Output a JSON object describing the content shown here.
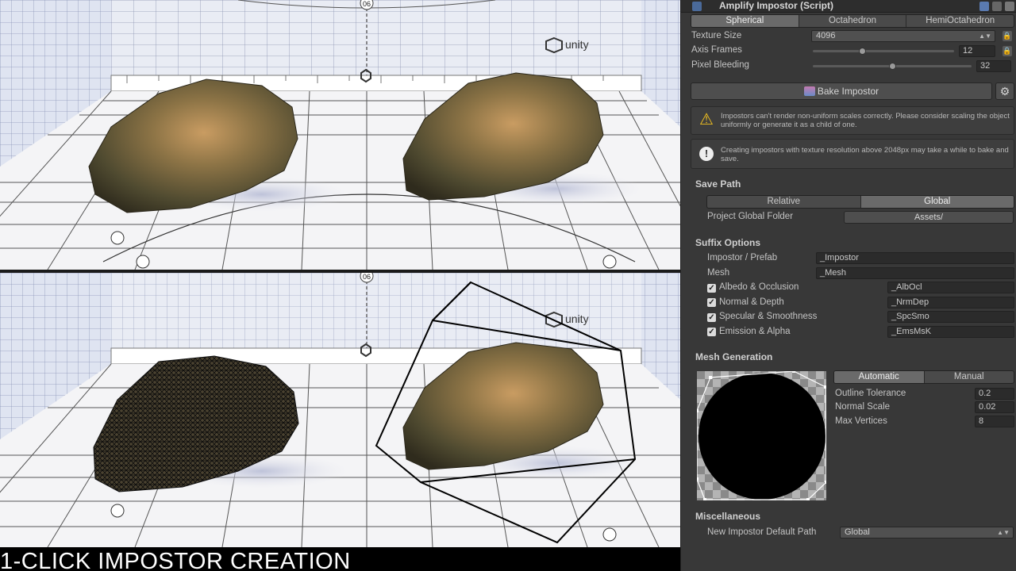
{
  "caption": "1-CLICK IMPOSTOR CREATION",
  "inspector": {
    "title": "Amplify Impostor (Script)",
    "projection_tabs": [
      "Spherical",
      "Octahedron",
      "HemiOctahedron"
    ],
    "active_projection": "Spherical",
    "texture_size": {
      "label": "Texture Size",
      "value": "4096"
    },
    "axis_frames": {
      "label": "Axis Frames",
      "value": "12",
      "fraction": 0.35
    },
    "pixel_bleeding": {
      "label": "Pixel Bleeding",
      "value": "32",
      "fraction": 0.5
    },
    "bake_button": "Bake Impostor",
    "warning": "Impostors can't render non-uniform scales correctly. Please consider scaling the object uniformly or generate it as a child of one.",
    "info": "Creating impostors with texture resolution above 2048px may take a while to bake and save.",
    "save_path": {
      "heading": "Save Path",
      "tabs": [
        "Relative",
        "Global"
      ],
      "active": "Global",
      "folder_label": "Project Global Folder",
      "folder_value": "Assets/"
    },
    "suffix_options": {
      "heading": "Suffix Options",
      "impostor_prefab_label": "Impostor / Prefab",
      "impostor_prefab_value": "_Impostor",
      "mesh_label": "Mesh",
      "mesh_value": "_Mesh",
      "maps": [
        {
          "label": "Albedo & Occlusion",
          "value": "_AlbOcl"
        },
        {
          "label": "Normal & Depth",
          "value": "_NrmDep"
        },
        {
          "label": "Specular & Smoothness",
          "value": "_SpcSmo"
        },
        {
          "label": "Emission & Alpha",
          "value": "_EmsMsK"
        }
      ]
    },
    "mesh_generation": {
      "heading": "Mesh Generation",
      "tabs": [
        "Automatic",
        "Manual"
      ],
      "active": "Automatic",
      "outline_tolerance": {
        "label": "Outline Tolerance",
        "value": "0.2"
      },
      "normal_scale": {
        "label": "Normal Scale",
        "value": "0.02"
      },
      "max_vertices": {
        "label": "Max Vertices",
        "value": "8"
      }
    },
    "miscellaneous": {
      "heading": "Miscellaneous",
      "default_path_label": "New Impostor Default Path",
      "default_path_value": "Global"
    }
  },
  "scene": {
    "logo_text": "unity",
    "ruler_top_number": "06"
  },
  "colors": {
    "panel": "#383838",
    "rock": "#6b5a3c",
    "rock_highlight": "#c79a5e",
    "floor": "#f2f2f2",
    "wall_grid": "#9aa8c8"
  }
}
